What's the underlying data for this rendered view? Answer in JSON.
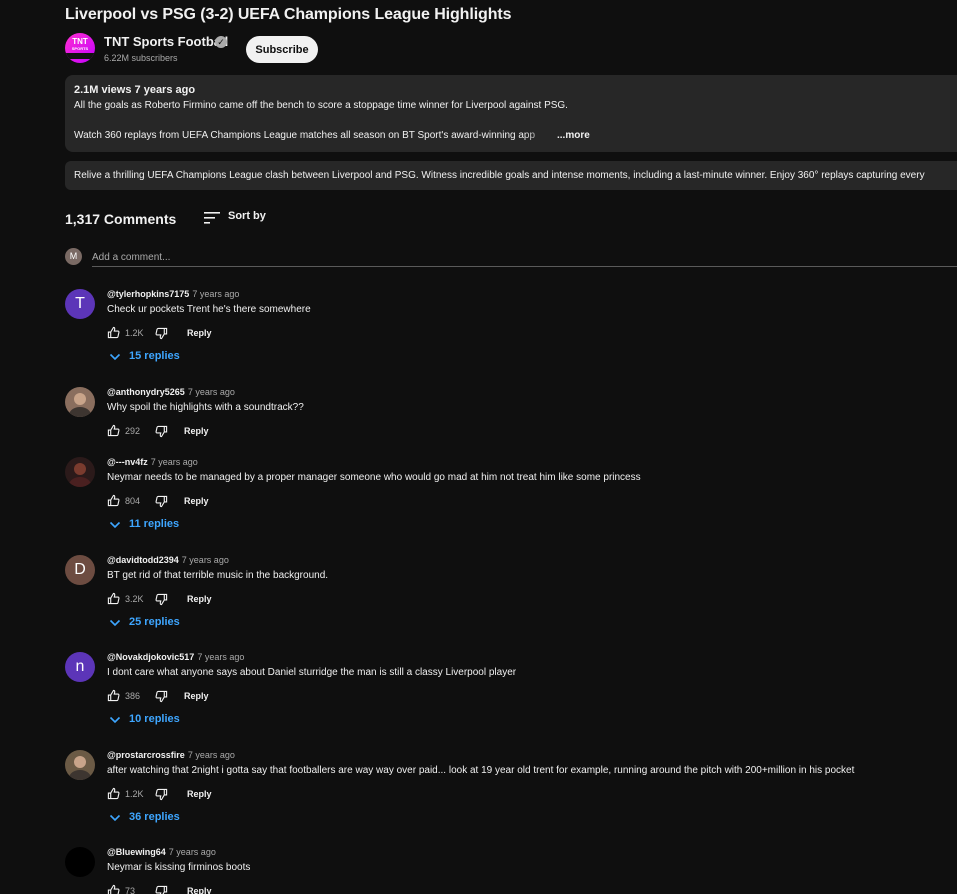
{
  "video": {
    "title": "Liverpool vs PSG (3-2) UEFA Champions League Highlights"
  },
  "channel": {
    "name": "TNT Sports Football",
    "subscribers": "6.22M subscribers",
    "avatar_text": "TNT",
    "avatar_subtext": "SPORTS",
    "subscribe_label": "Subscribe"
  },
  "description": {
    "meta": "2.1M views  7 years ago",
    "line1": "All the goals as Roberto Firmino came off the bench to score a stoppage time winner for Liverpool against PSG.",
    "line2": "Watch 360 replays from UEFA Champions League matches all season on BT Sport's award-winning app",
    "more_label": "...more"
  },
  "summary": {
    "text": "Relive a thrilling UEFA Champions League clash between Liverpool and PSG. Witness incredible goals and intense moments, including a last-minute winner. Enjoy 360° replays capturing every"
  },
  "comments_header": {
    "count": "1,317 Comments",
    "sort_label": "Sort by",
    "sort_icon": "sort-icon"
  },
  "add_comment": {
    "avatar_letter": "M",
    "placeholder": "Add a comment..."
  },
  "comments": [
    {
      "author": "@tylerhopkins7175",
      "time": "7 years ago",
      "text": "Check ur pockets Trent he's there somewhere",
      "likes": "1.2K",
      "reply_label": "Reply",
      "replies": "15 replies",
      "avatar_letter": "T",
      "avatar_color": "#5c35b8"
    },
    {
      "author": "@anthonydry5265",
      "time": "7 years ago",
      "text": "Why spoil the highlights with a soundtrack??",
      "likes": "292",
      "reply_label": "Reply",
      "replies": "",
      "avatar_letter": "",
      "avatar_color": "#8a6e5e"
    },
    {
      "author": "@---nv4fz",
      "time": "7 years ago",
      "text": "Neymar needs to be managed by a proper manager someone who would go mad at him not treat him like some princess",
      "likes": "804",
      "reply_label": "Reply",
      "replies": "11 replies",
      "avatar_letter": "",
      "avatar_color": "#2b1a1a"
    },
    {
      "author": "@davidtodd2394",
      "time": "7 years ago",
      "text": "BT get rid of that terrible music in the background.",
      "likes": "3.2K",
      "reply_label": "Reply",
      "replies": "25 replies",
      "avatar_letter": "D",
      "avatar_color": "#6d4c41"
    },
    {
      "author": "@Novakdjokovic517",
      "time": "7 years ago",
      "text": "I dont care what anyone says about Daniel sturridge the man is still a classy Liverpool player",
      "likes": "386",
      "reply_label": "Reply",
      "replies": "10 replies",
      "avatar_letter": "n",
      "avatar_color": "#5c35b8"
    },
    {
      "author": "@prostarcrossfire",
      "time": "7 years ago",
      "text": "after watching that 2night i gotta say that footballers are way way over paid... look at 19 year old trent for example, running around the pitch with 200+million in his pocket",
      "likes": "1.2K",
      "reply_label": "Reply",
      "replies": "36 replies",
      "avatar_letter": "",
      "avatar_color": "#6b5a45"
    },
    {
      "author": "@Bluewing64",
      "time": "7 years ago",
      "text": "Neymar is kissing firminos boots",
      "likes": "73",
      "reply_label": "Reply",
      "replies": "",
      "avatar_letter": "",
      "avatar_color": "#000000"
    }
  ],
  "colors": {
    "background": "#0f0f0f",
    "panel": "#272727",
    "link_blue": "#3ea6ff",
    "text_secondary": "#aaaaaa"
  }
}
